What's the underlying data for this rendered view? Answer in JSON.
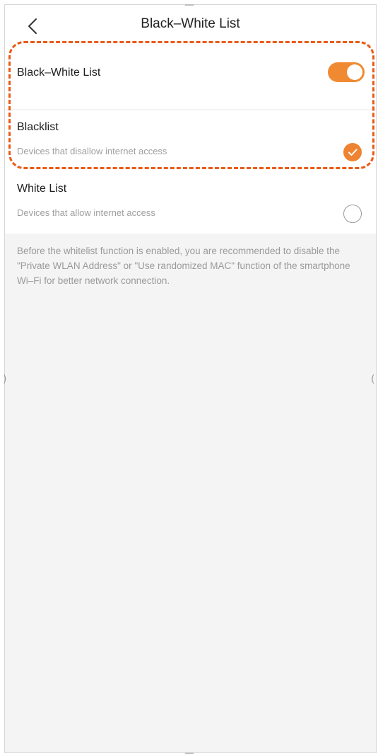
{
  "header": {
    "title": "Black–White List"
  },
  "toggle_section": {
    "label": "Black–White List",
    "enabled": true
  },
  "options": [
    {
      "title": "Blacklist",
      "description": "Devices that disallow internet access",
      "selected": true
    },
    {
      "title": "White List",
      "description": "Devices that allow internet access",
      "selected": false
    }
  ],
  "note": "Before the whitelist function is enabled, you are recommended to disable the \"Private WLAN Address\" or \"Use randomized MAC\" function of the smartphone Wi–Fi for better network connection.",
  "colors": {
    "accent": "#f08a32",
    "highlight": "#ea5a15"
  }
}
